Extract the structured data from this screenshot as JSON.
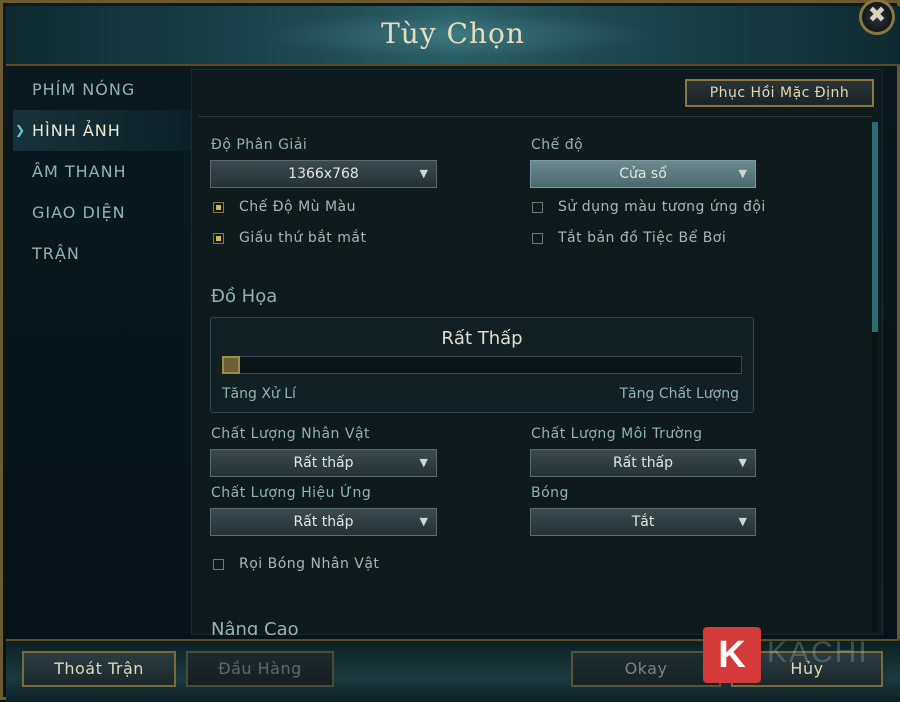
{
  "window": {
    "title": "Tùy Chọn",
    "close_symbol": "✖"
  },
  "sidebar": {
    "items": [
      {
        "label": "PHÍM NÓNG",
        "active": false
      },
      {
        "label": "HÌNH ẢNH",
        "active": true
      },
      {
        "label": "ÂM THANH",
        "active": false
      },
      {
        "label": "GIAO DIỆN",
        "active": false
      },
      {
        "label": "TRẬN",
        "active": false
      }
    ]
  },
  "panel": {
    "restore_label": "Phục Hồi Mặc Định",
    "resolution": {
      "label": "Độ Phân Giải",
      "value": "1366x768"
    },
    "mode": {
      "label": "Chế độ",
      "value": "Cửa sổ"
    },
    "checkboxes_left": [
      {
        "label": "Chế Độ Mù Màu",
        "checked": true
      },
      {
        "label": "Giấu thứ bắt mắt",
        "checked": true
      }
    ],
    "checkboxes_right": [
      {
        "label": "Sử dụng màu tương ứng đội",
        "checked": false
      },
      {
        "label": "Tắt bản đồ Tiệc Bể Bơi",
        "checked": false
      }
    ],
    "graphics": {
      "title": "Đồ Họa",
      "level_label": "Rất Thấp",
      "level_fraction": 0.0,
      "left_label": "Tăng Xử Lí",
      "right_label": "Tăng Chất Lượng"
    },
    "character_quality": {
      "label": "Chất Lượng Nhân Vật",
      "value": "Rất thấp"
    },
    "environment_quality": {
      "label": "Chất Lượng Môi Trường",
      "value": "Rất thấp"
    },
    "effects_quality": {
      "label": "Chất Lượng Hiệu Ứng",
      "value": "Rất thấp"
    },
    "shadows": {
      "label": "Bóng",
      "value": "Tắt"
    },
    "character_shadows": {
      "label": "Rọi Bóng Nhân Vật",
      "checked": false
    },
    "advanced_title": "Nâng Cao"
  },
  "footer": {
    "quit_label": "Thoát Trận",
    "surrender_label": "Đầu Hàng",
    "okay_label": "Okay",
    "cancel_label": "Hủy"
  },
  "watermark": {
    "logo_letter": "K",
    "text": "KACHI"
  },
  "colors": {
    "accent_gold": "#8a7640",
    "panel_bg": "#0f1a1d",
    "label_teal": "#8fb4b6"
  }
}
